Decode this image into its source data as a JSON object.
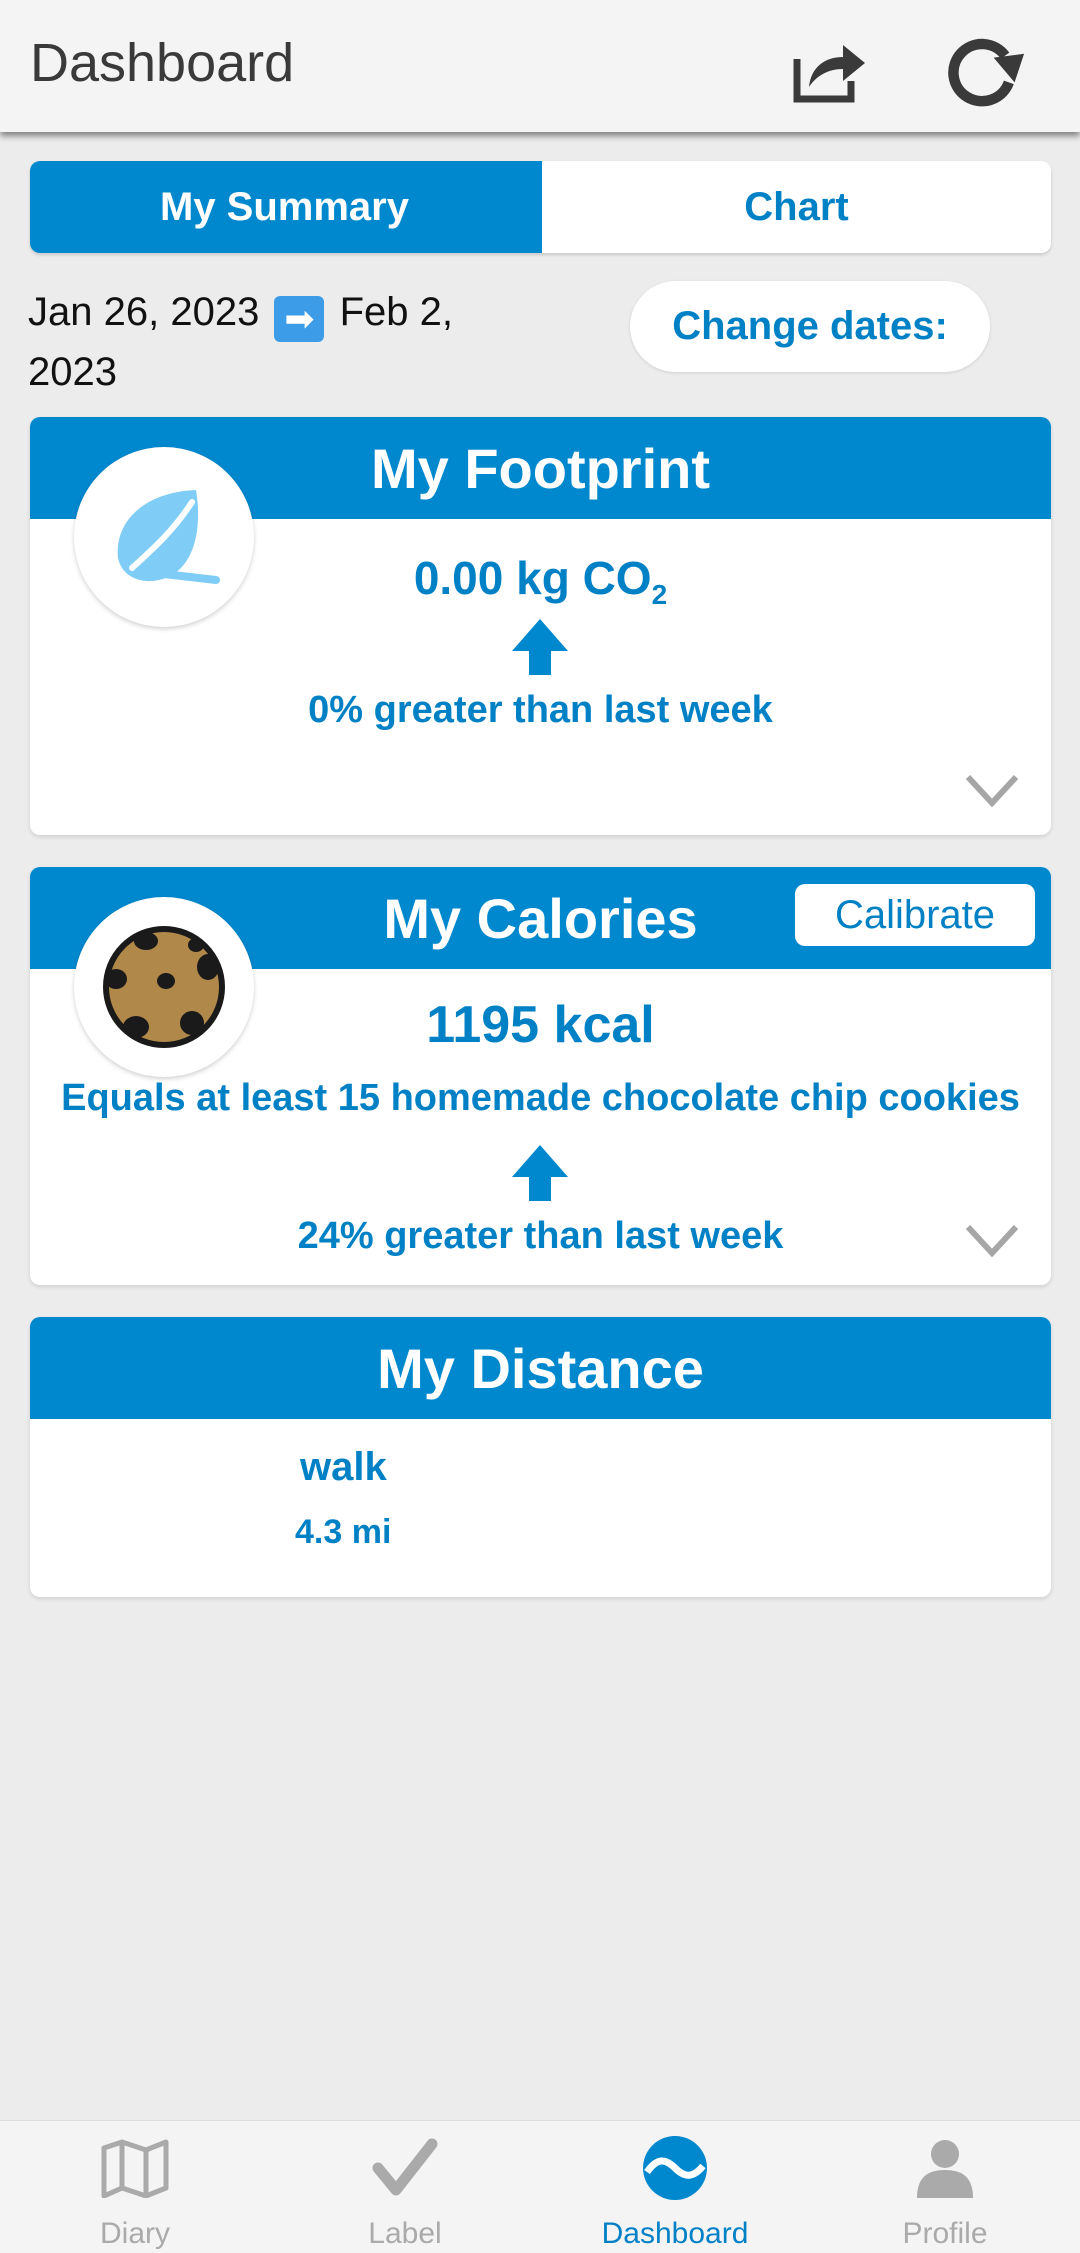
{
  "header": {
    "title": "Dashboard",
    "share_icon": "share-icon",
    "refresh_icon": "refresh-icon"
  },
  "tabs": [
    {
      "label": "My Summary",
      "active": true
    },
    {
      "label": "Chart",
      "active": false
    }
  ],
  "date_range": {
    "start": "Jan 26, 2023",
    "arrow": "➡",
    "end": "Feb 2,",
    "end_year": "2023",
    "change_label": "Change dates:"
  },
  "footprint": {
    "title": "My Footprint",
    "value": "0.00 kg CO",
    "subscript": "2",
    "comparison": "0% greater than last week",
    "icon": "leaf-icon"
  },
  "calories": {
    "title": "My Calories",
    "calibrate_label": "Calibrate",
    "value": "1195 kcal",
    "equivalent": "Equals at least 15 homemade chocolate chip cookies",
    "comparison": "24% greater than last week",
    "icon": "cookie-icon"
  },
  "distance": {
    "title": "My Distance",
    "mode": "walk",
    "value": "4.3 mi"
  },
  "nav": [
    {
      "label": "Diary",
      "icon": "map-icon",
      "active": false
    },
    {
      "label": "Label",
      "icon": "checkmark-icon",
      "active": false
    },
    {
      "label": "Dashboard",
      "icon": "dashboard-icon",
      "active": true
    },
    {
      "label": "Profile",
      "icon": "person-icon",
      "active": false
    }
  ],
  "colors": {
    "primary": "#0088ce",
    "text_blue": "#0080c5",
    "background": "#ececec"
  }
}
